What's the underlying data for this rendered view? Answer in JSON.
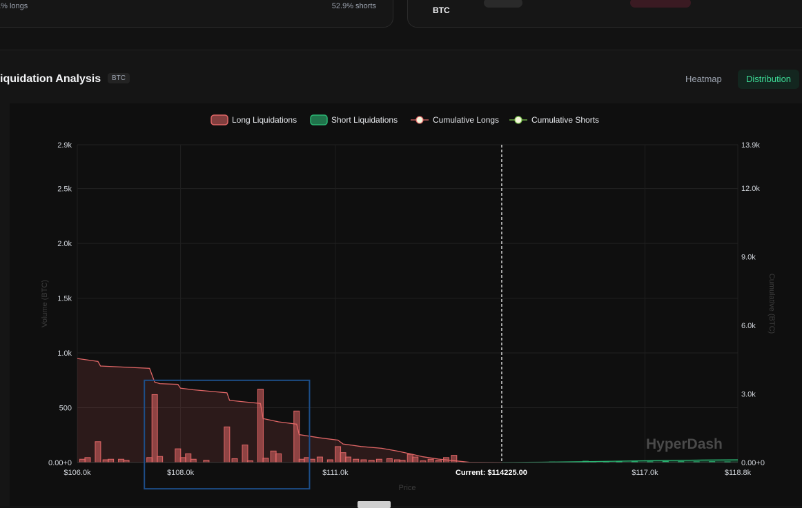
{
  "top_left": {
    "longs_text": "1% longs",
    "shorts_text": "52.9% shorts"
  },
  "top_right": {
    "symbol": "BTC"
  },
  "section": {
    "title": "iquidation Analysis",
    "badge": "BTC",
    "tabs": [
      {
        "label": "Heatmap"
      },
      {
        "label": "Distribution"
      }
    ],
    "active_tab": "Distribution"
  },
  "colors": {
    "long": "#e06666",
    "long_fill": "rgba(224,102,102,0.55)",
    "short": "#2bb673",
    "short_fill": "rgba(43,182,115,0.6)",
    "highlight_box": "#1d4e89"
  },
  "chart_data": {
    "type": "bar",
    "legend": [
      "Long Liquidations",
      "Short Liquidations",
      "Cumulative Longs",
      "Cumulative Shorts"
    ],
    "legend_position": "top-center",
    "xlabel": "Price",
    "ylabel": "Volume (BTC)",
    "y2label": "Cumulative (BTC)",
    "xlim": [
      106000,
      118800
    ],
    "ylim": [
      0,
      2900
    ],
    "y2lim": [
      0,
      13900
    ],
    "x_ticks": [
      "$106.0k",
      "$108.0k",
      "$111.0k",
      "$117.0k",
      "$118.8k"
    ],
    "y_ticks": [
      "0.00+0",
      "500",
      "1.0k",
      "1.5k",
      "2.0k",
      "2.5k",
      "2.9k"
    ],
    "y2_ticks": [
      "0.00+0",
      "3.0k",
      "6.0k",
      "9.0k",
      "12.0k",
      "13.9k"
    ],
    "current_price": 114225,
    "current_label": "Current: $114225.00",
    "watermark": "HyperDash",
    "long_bars": [
      {
        "x": 106100,
        "y": 30
      },
      {
        "x": 106200,
        "y": 45
      },
      {
        "x": 106400,
        "y": 190
      },
      {
        "x": 106550,
        "y": 25
      },
      {
        "x": 106650,
        "y": 30
      },
      {
        "x": 106850,
        "y": 30
      },
      {
        "x": 106950,
        "y": 20
      },
      {
        "x": 107400,
        "y": 45
      },
      {
        "x": 107500,
        "y": 620
      },
      {
        "x": 107600,
        "y": 55
      },
      {
        "x": 107950,
        "y": 125
      },
      {
        "x": 108050,
        "y": 45
      },
      {
        "x": 108150,
        "y": 80
      },
      {
        "x": 108250,
        "y": 30
      },
      {
        "x": 108500,
        "y": 20
      },
      {
        "x": 108900,
        "y": 325
      },
      {
        "x": 109050,
        "y": 35
      },
      {
        "x": 109250,
        "y": 160
      },
      {
        "x": 109350,
        "y": 15
      },
      {
        "x": 109550,
        "y": 670
      },
      {
        "x": 109650,
        "y": 40
      },
      {
        "x": 109800,
        "y": 105
      },
      {
        "x": 109900,
        "y": 80
      },
      {
        "x": 110250,
        "y": 470
      },
      {
        "x": 110350,
        "y": 30
      },
      {
        "x": 110450,
        "y": 45
      },
      {
        "x": 110550,
        "y": 30
      },
      {
        "x": 110700,
        "y": 50
      },
      {
        "x": 110900,
        "y": 25
      },
      {
        "x": 111050,
        "y": 145
      },
      {
        "x": 111150,
        "y": 90
      },
      {
        "x": 111250,
        "y": 50
      },
      {
        "x": 111400,
        "y": 30
      },
      {
        "x": 111550,
        "y": 25
      },
      {
        "x": 111700,
        "y": 20
      },
      {
        "x": 111850,
        "y": 30
      },
      {
        "x": 112050,
        "y": 35
      },
      {
        "x": 112200,
        "y": 25
      },
      {
        "x": 112300,
        "y": 20
      },
      {
        "x": 112450,
        "y": 75
      },
      {
        "x": 112550,
        "y": 50
      },
      {
        "x": 112700,
        "y": 15
      },
      {
        "x": 112850,
        "y": 30
      },
      {
        "x": 113000,
        "y": 20
      },
      {
        "x": 113150,
        "y": 45
      },
      {
        "x": 113300,
        "y": 65
      }
    ],
    "short_bars": [
      {
        "x": 115200,
        "y": 5
      },
      {
        "x": 115450,
        "y": 5
      },
      {
        "x": 115850,
        "y": 12
      },
      {
        "x": 116000,
        "y": 6
      },
      {
        "x": 116250,
        "y": 5
      },
      {
        "x": 116500,
        "y": 6
      },
      {
        "x": 116800,
        "y": 8
      },
      {
        "x": 117100,
        "y": 7
      },
      {
        "x": 117400,
        "y": 10
      },
      {
        "x": 117700,
        "y": 8
      },
      {
        "x": 118000,
        "y": 7
      },
      {
        "x": 118300,
        "y": 8
      },
      {
        "x": 118600,
        "y": 6
      }
    ],
    "cumulative_longs": [
      {
        "x": 106000,
        "y": 4550
      },
      {
        "x": 106400,
        "y": 4420
      },
      {
        "x": 106450,
        "y": 4220
      },
      {
        "x": 107400,
        "y": 4120
      },
      {
        "x": 107500,
        "y": 3520
      },
      {
        "x": 107600,
        "y": 3450
      },
      {
        "x": 107950,
        "y": 3420
      },
      {
        "x": 108000,
        "y": 3250
      },
      {
        "x": 108250,
        "y": 3180
      },
      {
        "x": 108900,
        "y": 3050
      },
      {
        "x": 108950,
        "y": 2720
      },
      {
        "x": 109250,
        "y": 2650
      },
      {
        "x": 109550,
        "y": 2580
      },
      {
        "x": 109600,
        "y": 1920
      },
      {
        "x": 109900,
        "y": 1780
      },
      {
        "x": 110250,
        "y": 1680
      },
      {
        "x": 110300,
        "y": 1220
      },
      {
        "x": 110700,
        "y": 1080
      },
      {
        "x": 111050,
        "y": 980
      },
      {
        "x": 111150,
        "y": 810
      },
      {
        "x": 111500,
        "y": 700
      },
      {
        "x": 111900,
        "y": 620
      },
      {
        "x": 112200,
        "y": 500
      },
      {
        "x": 112450,
        "y": 380
      },
      {
        "x": 112700,
        "y": 250
      },
      {
        "x": 113000,
        "y": 150
      },
      {
        "x": 113300,
        "y": 80
      },
      {
        "x": 113600,
        "y": 10
      },
      {
        "x": 114225,
        "y": 0
      }
    ],
    "cumulative_shorts": [
      {
        "x": 114225,
        "y": 0
      },
      {
        "x": 115000,
        "y": 15
      },
      {
        "x": 115800,
        "y": 35
      },
      {
        "x": 116500,
        "y": 60
      },
      {
        "x": 117300,
        "y": 85
      },
      {
        "x": 118000,
        "y": 105
      },
      {
        "x": 118800,
        "y": 120
      }
    ]
  },
  "highlight_box": {
    "x_range": [
      107300,
      110500
    ],
    "y_range": [
      -240,
      750
    ]
  }
}
